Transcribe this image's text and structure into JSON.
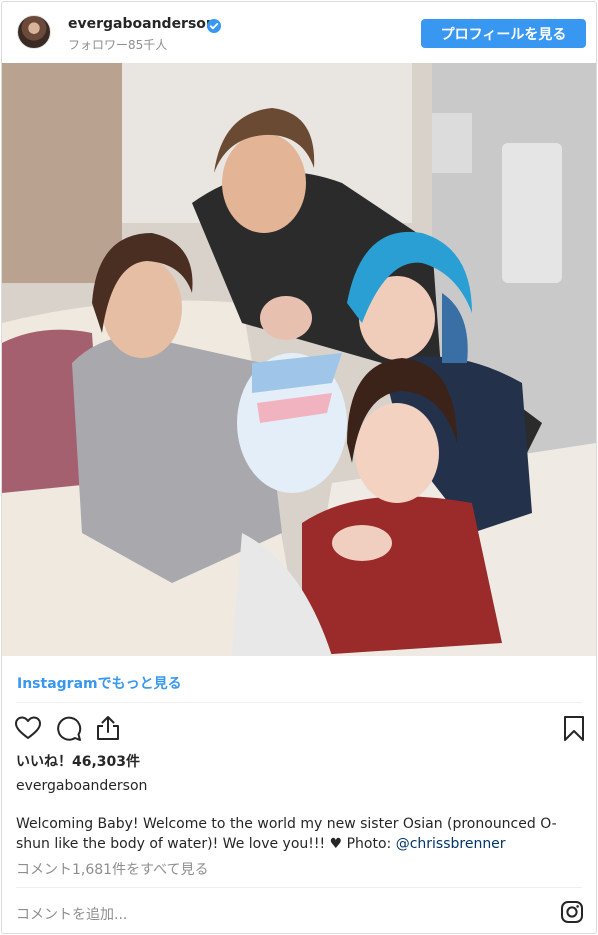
{
  "header": {
    "username": "evergaboanderson",
    "followers": "フォロワー85千人",
    "profile_button": "プロフィールを見る",
    "verified_icon": "verified-badge-icon"
  },
  "post": {
    "more_link": "Instagramでもっと見る",
    "likes": "いいね！46,303件",
    "caption_user": "evergaboanderson",
    "caption_text": "Welcoming Baby! Welcome to the world my new sister Osian (pronounced O-shun like the body of water)! We love you!!! ♥ Photo: ",
    "caption_mention": "@chrissbrenner",
    "view_comments": "コメント1,681件をすべて見る",
    "comment_placeholder": "コメントを追加..."
  },
  "icons": {
    "like": "heart-icon",
    "comment": "comment-bubble-icon",
    "share": "share-icon",
    "save": "bookmark-icon",
    "instagram": "instagram-logo-icon"
  },
  "colors": {
    "accent": "#3897f0",
    "mention": "#003569",
    "muted": "#8e8e8e"
  }
}
